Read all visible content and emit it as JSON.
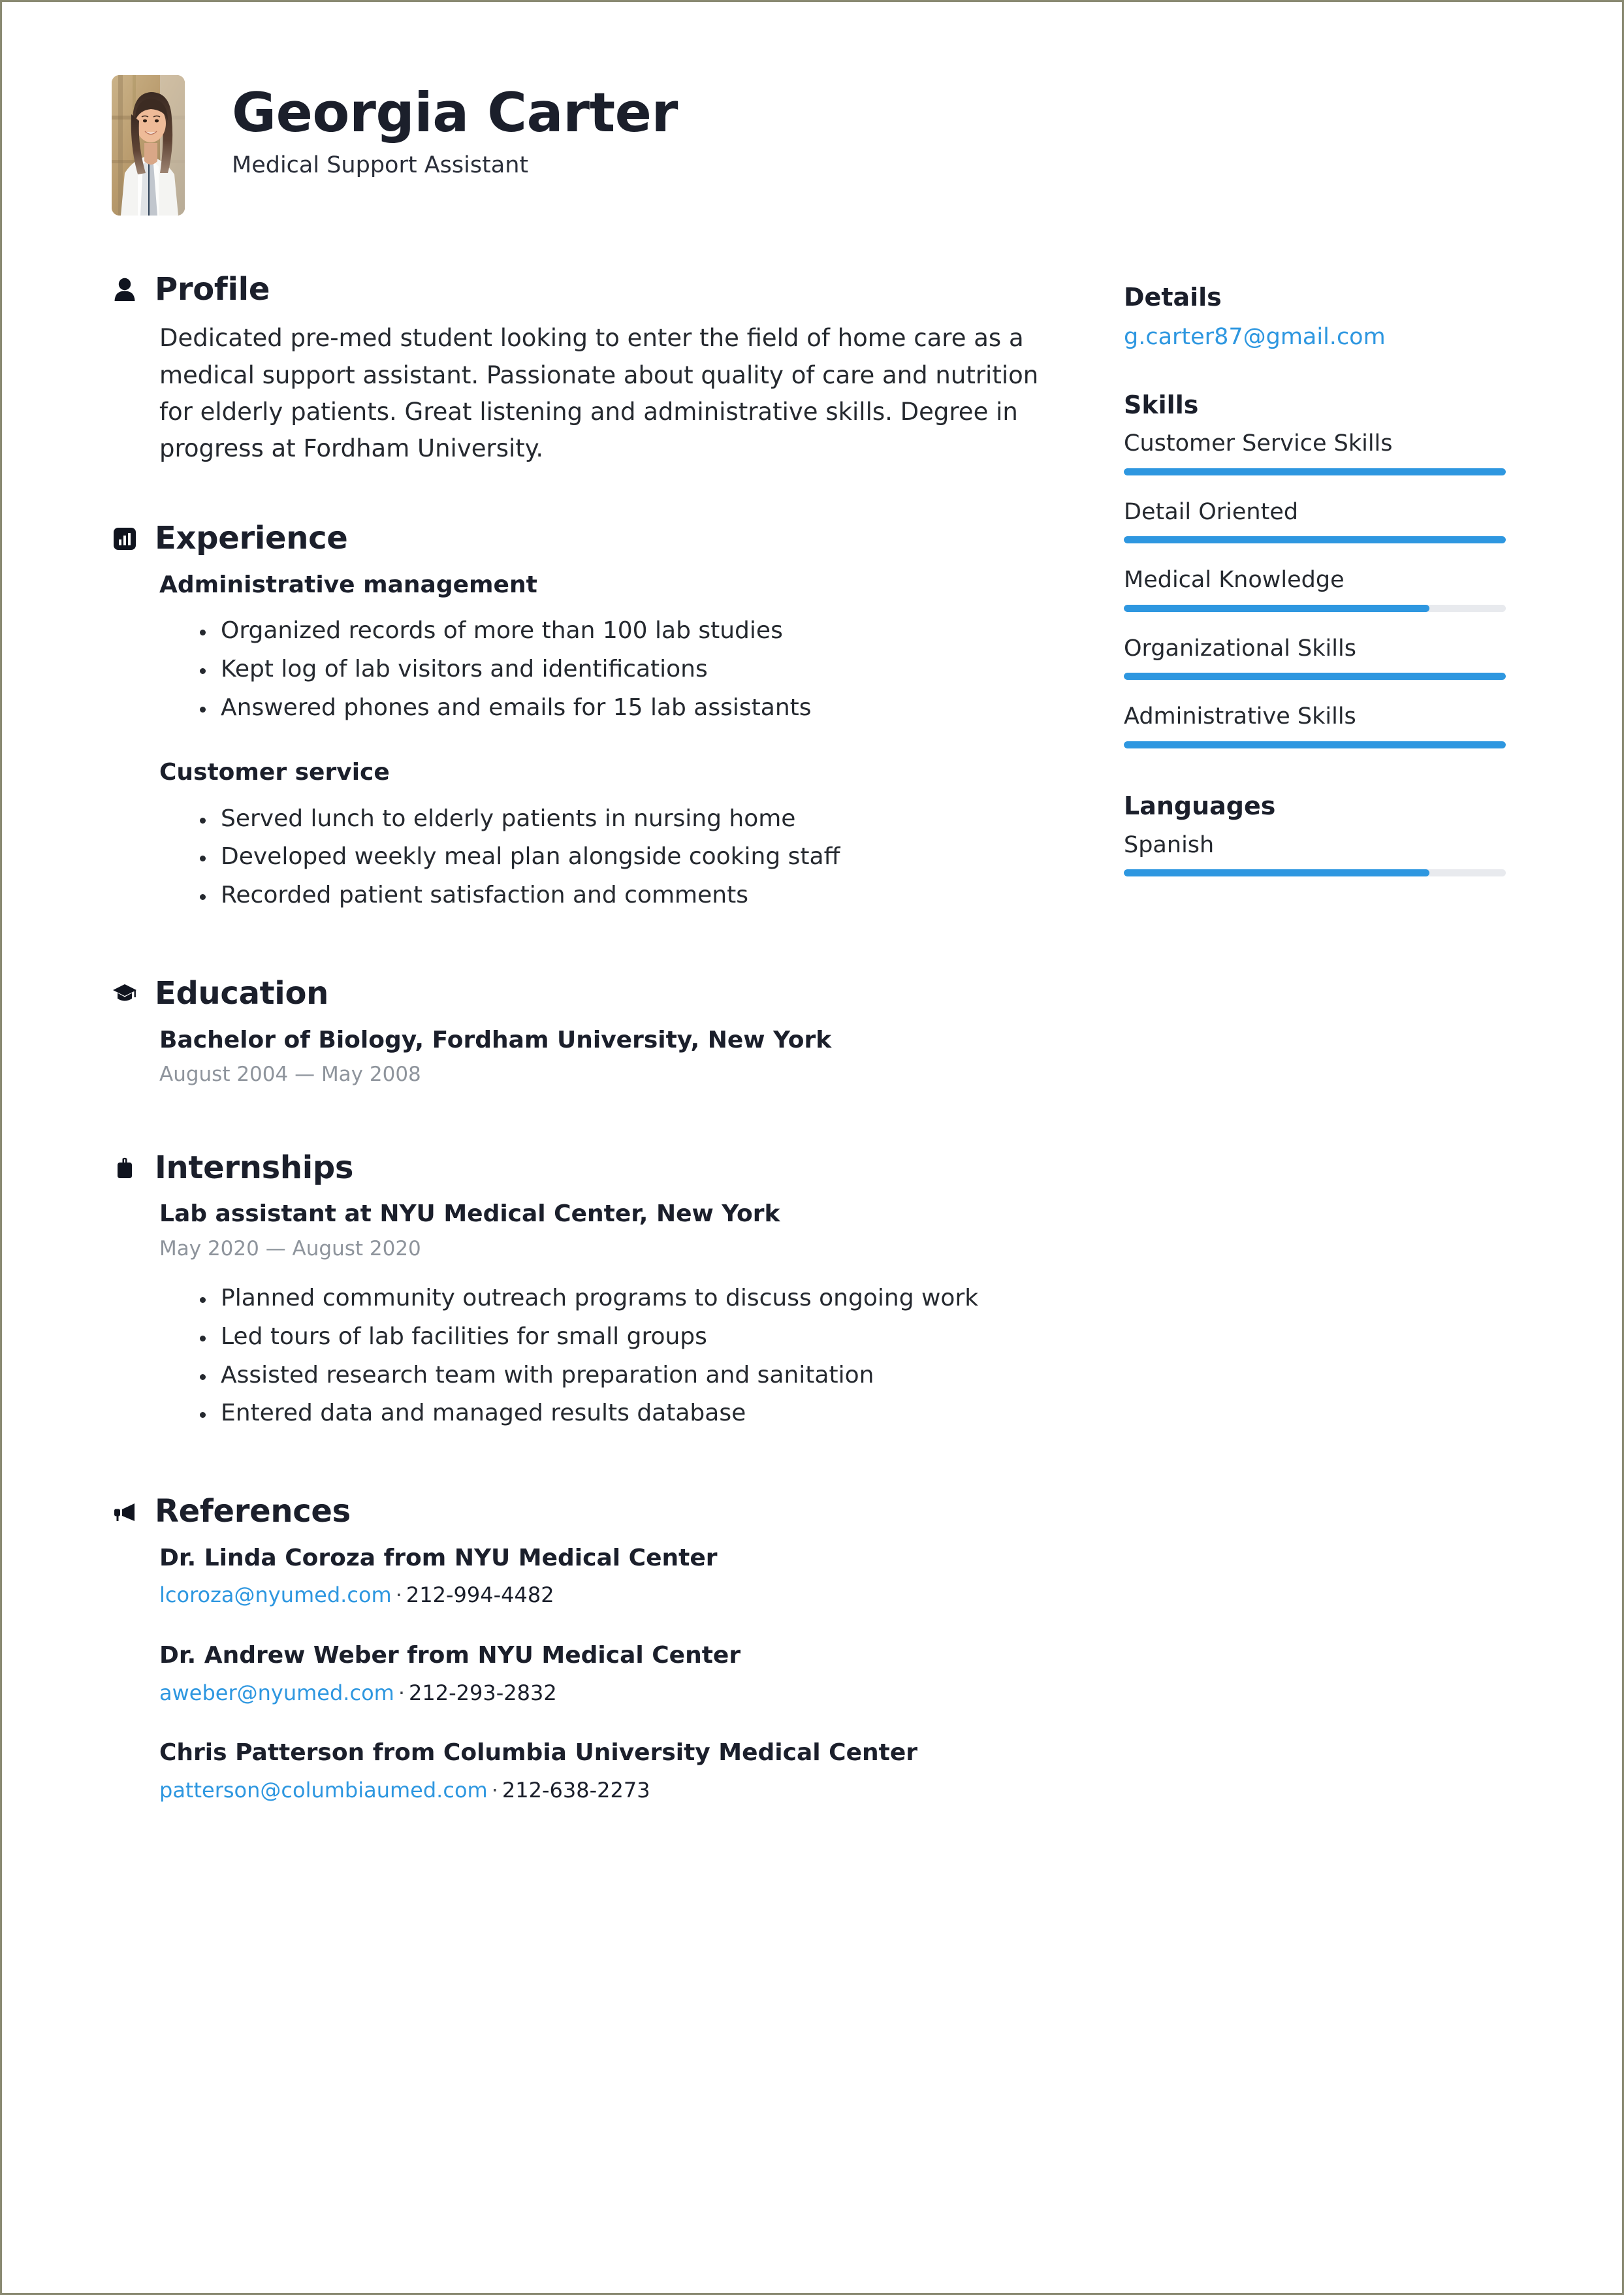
{
  "header": {
    "name": "Georgia Carter",
    "job_title": "Medical Support Assistant",
    "photo_alt": "profile-photo"
  },
  "accent_color": "#2e97e0",
  "text_color": "#25292f",
  "muted_color": "#8e949c",
  "sections": {
    "profile": {
      "title": "Profile",
      "icon": "person-icon",
      "text": "Dedicated pre-med student looking to enter the field of home care as a medical support assistant. Passionate about quality of care and nutrition for elderly patients. Great listening and administrative skills. Degree in progress at Fordham University."
    },
    "experience": {
      "title": "Experience",
      "icon": "bar-chart-icon",
      "entries": [
        {
          "title": "Administrative management",
          "bullets": [
            "Organized records of more than 100 lab studies",
            "Kept log of lab visitors and identifications",
            "Answered phones and emails for 15 lab assistants"
          ]
        },
        {
          "title": "Customer service",
          "bullets": [
            "Served lunch to elderly patients in nursing home",
            "Developed weekly meal plan alongside cooking staff",
            "Recorded patient satisfaction and comments"
          ]
        }
      ]
    },
    "education": {
      "title": "Education",
      "icon": "graduation-cap-icon",
      "entries": [
        {
          "title": "Bachelor of Biology, Fordham University, New York",
          "date": "August 2004 — May 2008"
        }
      ]
    },
    "internships": {
      "title": "Internships",
      "icon": "briefcase-icon",
      "entries": [
        {
          "title": "Lab assistant at NYU Medical Center, New York",
          "date": "May 2020 — August 2020",
          "bullets": [
            "Planned community outreach programs to discuss ongoing work",
            "Led tours of lab facilities for small groups",
            "Assisted research team with preparation and sanitation",
            "Entered data and managed results database"
          ]
        }
      ]
    },
    "references": {
      "title": "References",
      "icon": "megaphone-icon",
      "entries": [
        {
          "name": "Dr. Linda Coroza from NYU Medical Center",
          "email": "lcoroza@nyumed.com",
          "separator": "·",
          "phone": "212-994-4482"
        },
        {
          "name": "Dr. Andrew Weber from NYU Medical Center",
          "email": "aweber@nyumed.com",
          "separator": "·",
          "phone": "212-293-2832"
        },
        {
          "name": "Chris Patterson from Columbia University Medical Center",
          "email": "patterson@columbiaumed.com",
          "separator": "·",
          "phone": "212-638-2273"
        }
      ]
    }
  },
  "sidebar": {
    "details": {
      "title": "Details",
      "email": "g.carter87@gmail.com"
    },
    "skills": {
      "title": "Skills",
      "items": [
        {
          "label": "Customer Service Skills",
          "level": 100
        },
        {
          "label": "Detail Oriented",
          "level": 100
        },
        {
          "label": "Medical Knowledge",
          "level": 80
        },
        {
          "label": "Organizational Skills",
          "level": 100
        },
        {
          "label": "Administrative Skills",
          "level": 100
        }
      ]
    },
    "languages": {
      "title": "Languages",
      "items": [
        {
          "label": "Spanish",
          "level": 80
        }
      ]
    }
  }
}
